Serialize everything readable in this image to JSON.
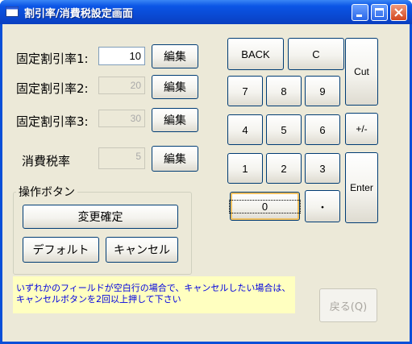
{
  "window": {
    "title": "割引率/消費税設定画面"
  },
  "rates": [
    {
      "label": "固定割引率1:",
      "value": "10",
      "edit": "編集",
      "enabled": true
    },
    {
      "label": "固定割引率2:",
      "value": "20",
      "edit": "編集",
      "enabled": false
    },
    {
      "label": "固定割引率3:",
      "value": "30",
      "edit": "編集",
      "enabled": false
    }
  ],
  "tax": {
    "label": "消費税率",
    "value": "5",
    "edit": "編集"
  },
  "group": {
    "title": "操作ボタン",
    "confirm": "変更確定",
    "default": "デフォルト",
    "cancel": "キャンセル"
  },
  "keypad": {
    "back": "BACK",
    "clear": "C",
    "cut": "Cut",
    "k7": "7",
    "k8": "8",
    "k9": "9",
    "k4": "4",
    "k5": "5",
    "k6": "6",
    "sign": "+/-",
    "k1": "1",
    "k2": "2",
    "k3": "3",
    "enter": "Enter",
    "k0": "0",
    "dot": "・"
  },
  "note": {
    "line1": "いずれかのフィールドが空白行の場合で、キャンセルしたい場合は、",
    "line2": "キャンセルボタンを2回以上押して下さい"
  },
  "return_button": "戻る(Q)"
}
